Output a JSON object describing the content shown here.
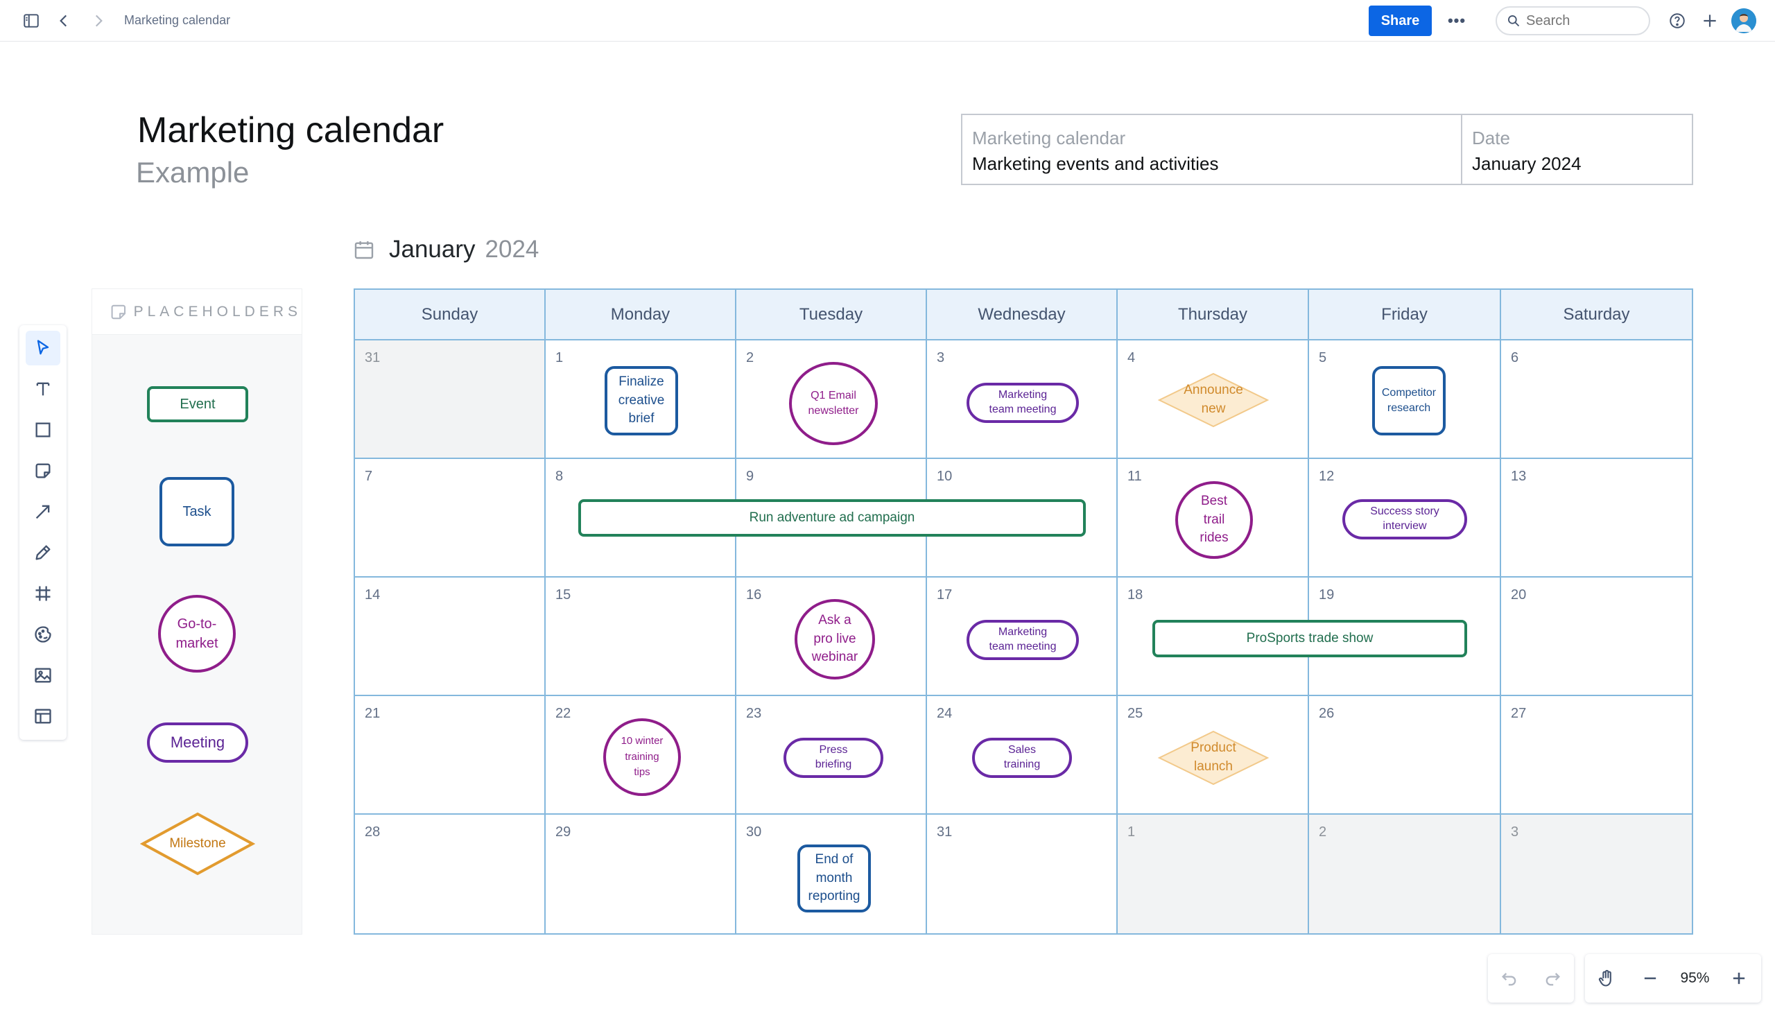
{
  "topbar": {
    "breadcrumb": "Marketing calendar",
    "share_label": "Share",
    "more_label": "•••",
    "search_placeholder": "Search"
  },
  "page": {
    "title": "Marketing calendar",
    "subtitle": "Example"
  },
  "info_table": {
    "col1_label": "Marketing calendar",
    "col1_value": "Marketing events and activities",
    "col2_label": "Date",
    "col2_value": "January 2024"
  },
  "calendar": {
    "month": "January",
    "year": "2024",
    "day_headers": [
      "Sunday",
      "Monday",
      "Tuesday",
      "Wednesday",
      "Thursday",
      "Friday",
      "Saturday"
    ],
    "weeks": [
      [
        "31",
        "1",
        "2",
        "3",
        "4",
        "5",
        "6"
      ],
      [
        "7",
        "8",
        "9",
        "10",
        "11",
        "12",
        "13"
      ],
      [
        "14",
        "15",
        "16",
        "17",
        "18",
        "19",
        "20"
      ],
      [
        "21",
        "22",
        "23",
        "24",
        "25",
        "26",
        "27"
      ],
      [
        "28",
        "29",
        "30",
        "31",
        "1",
        "2",
        "3"
      ]
    ],
    "items": {
      "finalize_brief": "Finalize creative brief",
      "q1_newsletter": "Q1 Email newsletter",
      "mkt_meeting_1": "Marketing team meeting",
      "announce_new": "Announce new",
      "competitor_research": "Competitor research",
      "adventure_campaign": "Run adventure ad campaign",
      "best_trail_rides": "Best trail rides",
      "success_story": "Success story interview",
      "pro_live_webinar": "Ask a pro live webinar",
      "mkt_meeting_2": "Marketing team meeting",
      "prosports_trade_show": "ProSports trade show",
      "winter_tips": "10 winter training tips",
      "press_briefing": "Press briefing",
      "sales_training": "Sales training",
      "product_launch": "Product launch",
      "month_end_reporting": "End of month reporting"
    }
  },
  "placeholders": {
    "title": "PLACEHOLDERS",
    "event": "Event",
    "task": "Task",
    "go_to_market": "Go-to-market",
    "meeting": "Meeting",
    "milestone": "Milestone"
  },
  "zoom": {
    "level": "95%"
  },
  "colors": {
    "event": "#22825a",
    "task": "#1c5aa0",
    "go_to_market": "#8f1d8a",
    "meeting": "#6a2aa6",
    "milestone": "#e29b2f",
    "grid": "#84b8dd",
    "accent": "#0c66e4"
  }
}
